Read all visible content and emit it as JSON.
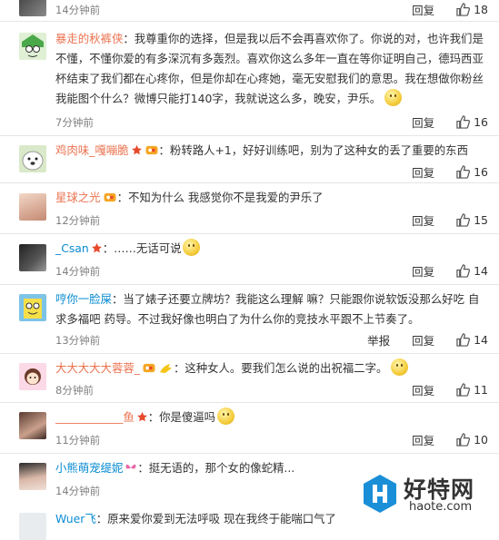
{
  "actions": {
    "reply": "回复",
    "report": "举报"
  },
  "comments": [
    {
      "user": "",
      "text": "",
      "time": "14分钟前",
      "likes": "18"
    },
    {
      "user": "暴走的秋裤侠",
      "text": "：我尊重你的选择，但是我以后不会再喜欢你了。你说的对，也许我们是不懂，不懂你爱的有多深沉有多轰烈。喜欢你这么多年一直在等你证明自己，德玛西亚杯结束了我们都在心疼你，但是你却在心疼她，毫无安慰我们的意思。我在想做你粉丝我能图个什么？微博只能打140字，我就说这么多，晚安，尹乐。",
      "time": "7分钟前",
      "likes": "16"
    },
    {
      "user": "鸡肉味_嘎嘣脆",
      "text": "：粉转路人+1，好好训练吧，别为了这种女的丢了重要的东西",
      "time": "",
      "likes": "16"
    },
    {
      "user": "星球之光",
      "text": "：不知为什么 我感觉你不是我爱的尹乐了",
      "time": "12分钟前",
      "likes": "15"
    },
    {
      "user": "_Csan",
      "text": "：……无话可说",
      "time": "14分钟前",
      "likes": "14"
    },
    {
      "user": "哼你一脸屎",
      "text": "：当了婊子还要立牌坊？我能这么理解 嘛？只能跟你说软饭没那么好吃 自求多福吧 药导。不过我好像也明白了为什么你的竞技水平跟不上节奏了。",
      "time": "13分钟前",
      "likes": "14"
    },
    {
      "user": "大大大大大蓉蓉_",
      "text": "：这种女人。要我们怎么说的出祝福二字。",
      "time": "8分钟前",
      "likes": "11"
    },
    {
      "user": "____________鱼",
      "text": "：你是傻逼吗",
      "time": "11分钟前",
      "likes": "10"
    },
    {
      "user": "小熊萌宠缇妮",
      "text": "：挺无语的，那个女的像蛇精...",
      "time": "14分钟前",
      "likes": ""
    },
    {
      "user": "Wuer飞",
      "text": "：原来爱你爱到无法呼吸 现在我终于能喘口气了",
      "time": "",
      "likes": ""
    }
  ],
  "watermark": {
    "brand": "好特网",
    "site": "haote.com"
  }
}
